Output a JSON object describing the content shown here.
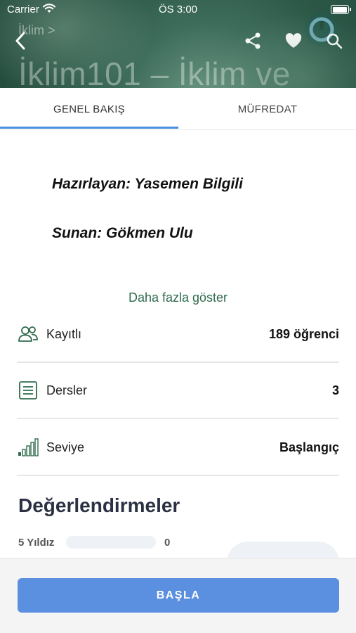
{
  "status_bar": {
    "carrier": "Carrier",
    "time": "ÖS 3:00"
  },
  "header": {
    "breadcrumb": "İklim >",
    "title": "İklim101 – İklim ve",
    "icons": [
      "chevron-left-icon",
      "share-icon",
      "heart-icon",
      "search-icon"
    ]
  },
  "tabs": [
    {
      "label": "GENEL BAKIŞ",
      "active": true
    },
    {
      "label": "MÜFREDAT",
      "active": false
    }
  ],
  "description": {
    "prepared_by": "Hazırlayan: Yasemen Bilgili",
    "presented_by": "Sunan: Gökmen Ulu",
    "show_more": "Daha fazla göster"
  },
  "stats": [
    {
      "icon": "users-icon",
      "label": "Kayıtlı",
      "value": "189 öğrenci"
    },
    {
      "icon": "list-document-icon",
      "label": "Dersler",
      "value": "3"
    },
    {
      "icon": "signal-bars-icon",
      "label": "Seviye",
      "value": "Başlangıç"
    }
  ],
  "reviews": {
    "title": "Değerlendirmeler",
    "rows": [
      {
        "label": "5 Yıldız",
        "count": "0",
        "fraction": 0
      }
    ]
  },
  "cta": {
    "label": "BAŞLA"
  },
  "colors": {
    "accent_tab": "#4a90e2",
    "accent_green": "#2f6b4d",
    "button": "#5b8fe0"
  }
}
